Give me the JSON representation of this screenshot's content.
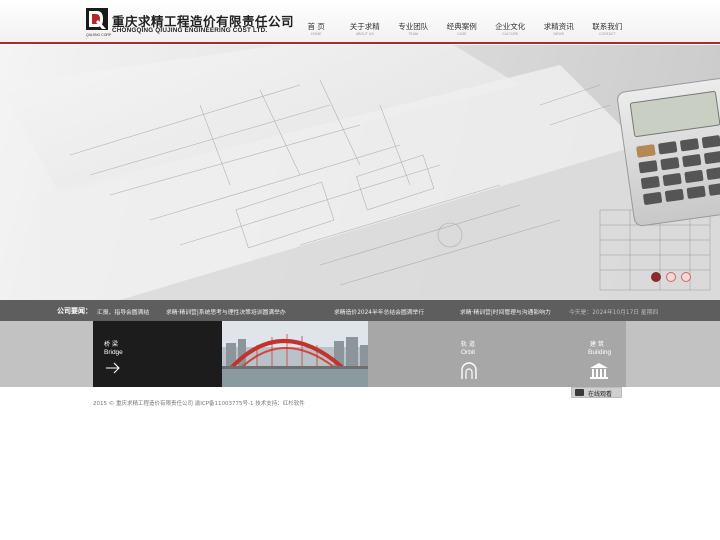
{
  "header": {
    "logo_cn": "重庆求精工程造价有限责任公司",
    "logo_en": "CHONGQING QIUJING ENGINEERING COST LTD.",
    "logo_sub": "QIUJING CORP"
  },
  "nav": [
    {
      "cn": "首 页",
      "en": "HOME"
    },
    {
      "cn": "关于求精",
      "en": "ABOUT US"
    },
    {
      "cn": "专业团队",
      "en": "TEAM"
    },
    {
      "cn": "经典案例",
      "en": "CASE"
    },
    {
      "cn": "企业文化",
      "en": "CULTURE"
    },
    {
      "cn": "求精资讯",
      "en": "NEWS"
    },
    {
      "cn": "联系我们",
      "en": "CONTACT"
    }
  ],
  "slider": {
    "count": 3,
    "active": 0
  },
  "news": {
    "label": "公司要闻：",
    "items": [
      "汇报、指导会圆满结",
      "求精·精训营|系统思考与理性决策培训圆满举办",
      "求精造价2024半年总结会圆满举行",
      "求精·精训营|时间管理与沟通影响力"
    ],
    "date": "今天是：2024年10月17日 星期四"
  },
  "tiles": {
    "bridge": {
      "cn": "桥梁",
      "en": "Bridge",
      "icon": "arrow-right-icon"
    },
    "orbit": {
      "cn": "轨道",
      "en": "Orbit",
      "icon": "tunnel-icon"
    },
    "building": {
      "cn": "建筑",
      "en": "Building",
      "icon": "building-icon"
    }
  },
  "video": {
    "label": "在线观看",
    "icon": "video-icon"
  },
  "footer": {
    "text": "2015 © 重庆求精工程造价有限责任公司 渝ICP备11003775号-1 技术支持：红杉软件"
  },
  "colors": {
    "accent": "#b3262b",
    "news_bg": "#5e5e5e",
    "band_bg": "#a7a7a7"
  }
}
